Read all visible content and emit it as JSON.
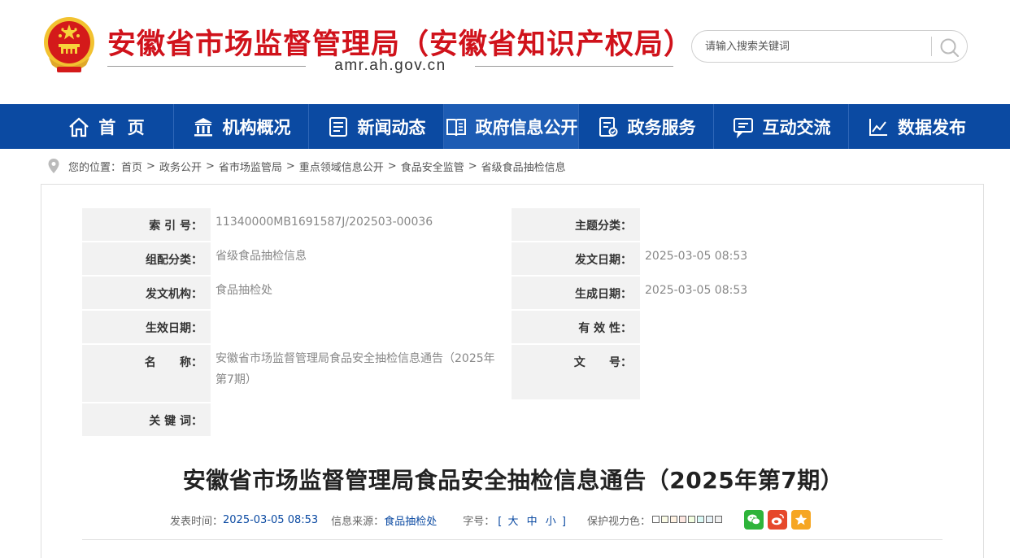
{
  "header": {
    "site_title": "安徽省市场监督管理局（安徽省知识产权局）",
    "domain": "amr.ah.gov.cn",
    "search_placeholder": "请输入搜索关键词"
  },
  "nav": {
    "items": [
      {
        "label": "首  页",
        "icon": "home-icon"
      },
      {
        "label": "机构概况",
        "icon": "institution-icon"
      },
      {
        "label": "新闻动态",
        "icon": "news-icon"
      },
      {
        "label": "政府信息公开",
        "icon": "book-icon"
      },
      {
        "label": "政务服务",
        "icon": "service-icon"
      },
      {
        "label": "互动交流",
        "icon": "chat-icon"
      },
      {
        "label": "数据发布",
        "icon": "chart-icon"
      }
    ],
    "active_index": 3
  },
  "breadcrumb": {
    "prefix": "您的位置：",
    "items": [
      "首页",
      "政务公开",
      "省市场监管局",
      "重点领域信息公开",
      "食品安全监管",
      "省级食品抽检信息"
    ],
    "separator": ">"
  },
  "meta": {
    "index_label": "索 引 号：",
    "index_value": "11340000MB1691587J/202503-00036",
    "topic_label": "主题分类：",
    "topic_value": "",
    "category_label": "组配分类：",
    "category_value": "省级食品抽检信息",
    "issue_date_label": "发文日期：",
    "issue_date_value": "2025-03-05 08:53",
    "org_label": "发文机构：",
    "org_value": "食品抽检处",
    "gen_date_label": "生成日期：",
    "gen_date_value": "2025-03-05 08:53",
    "effective_label": "生效日期：",
    "effective_value": "",
    "validity_label": "有 效 性：",
    "validity_value": "",
    "name_label": "名      称：",
    "name_value": "安徽省市场监督管理局食品安全抽检信息通告（2025年第7期）",
    "doc_no_label": "文      号：",
    "doc_no_value": "",
    "keywords_label": "关 键 词：",
    "keywords_value": ""
  },
  "article": {
    "title": "安徽省市场监督管理局食品安全抽检信息通告（2025年第7期）",
    "publish_label": "发表时间：",
    "publish_value": "2025-03-05 08:53",
    "source_label": "信息来源：",
    "source_value": "食品抽检处",
    "font_label": "字号：",
    "font_open": "[",
    "font_large": "大",
    "font_medium": "中",
    "font_small": "小",
    "font_close": "]",
    "eye_label": "保护视力色：",
    "swatches": [
      "#ffffff",
      "#fafbe6",
      "#fff2e2",
      "#fde6e0",
      "#f3ffe1",
      "#dafaf7",
      "#e8f3f8",
      "#f0f0f0"
    ],
    "share": [
      {
        "name": "wechat-icon",
        "color": "#2eb43a"
      },
      {
        "name": "weibo-icon",
        "color": "#e6482b"
      },
      {
        "name": "favorite-icon",
        "color": "#f6a623"
      }
    ]
  },
  "colors": {
    "brand_red": "#d0121b",
    "nav_blue": "#0b4aa2",
    "nav_active": "#1d5cb4"
  }
}
